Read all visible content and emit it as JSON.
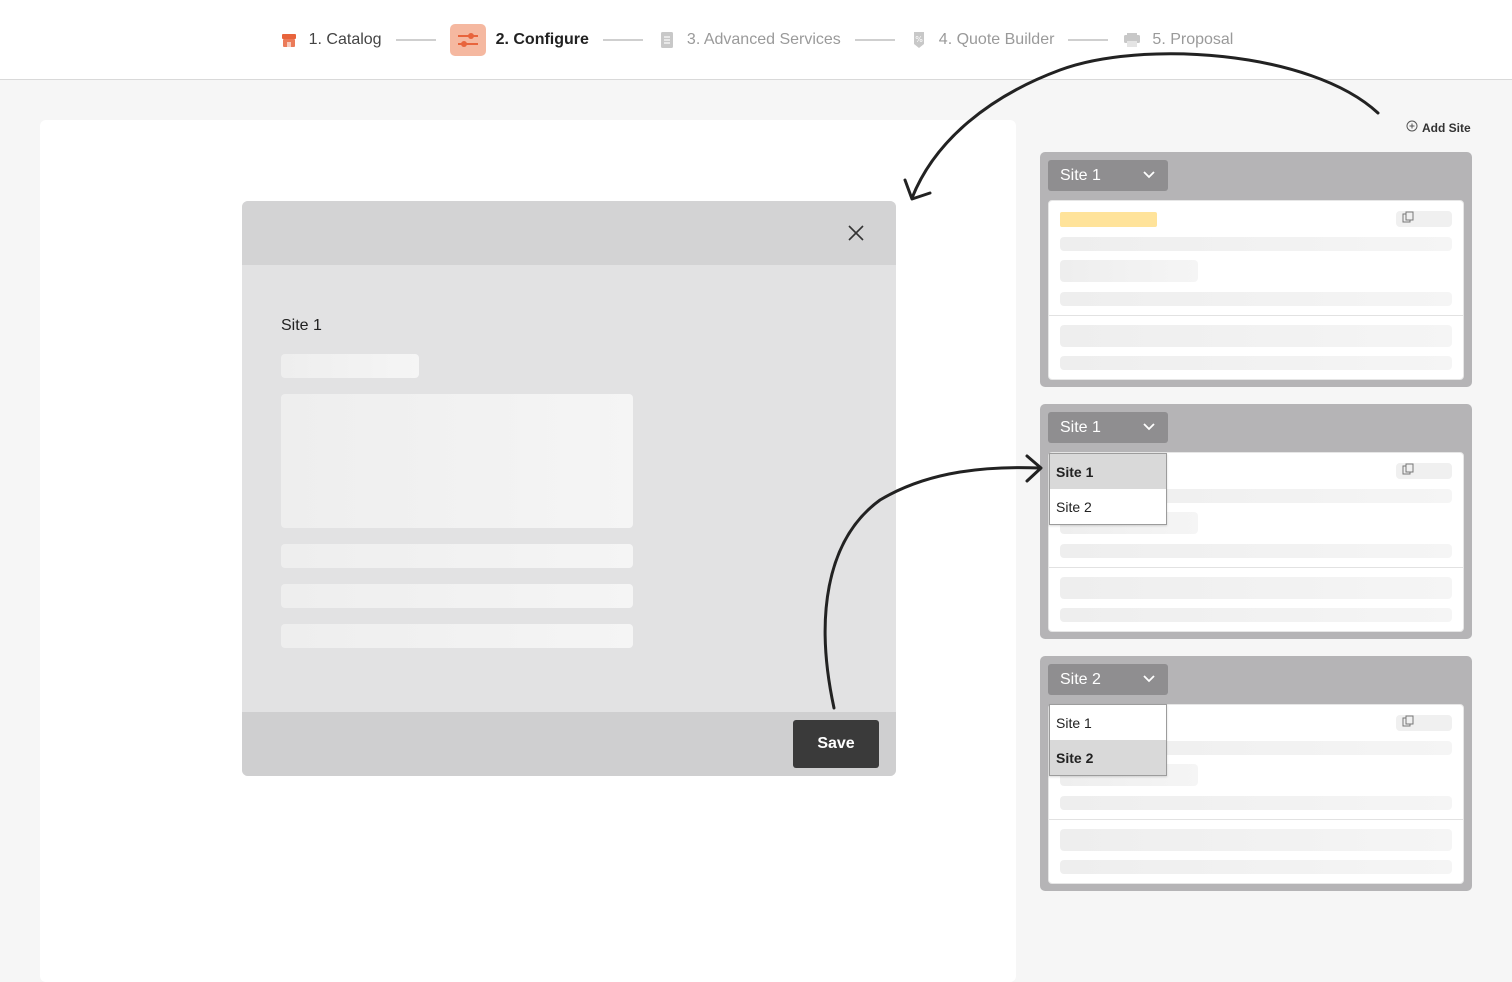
{
  "stepper": {
    "steps": [
      {
        "label": "1. Catalog",
        "icon": "store-icon",
        "state": "done"
      },
      {
        "label": "2. Configure",
        "icon": "sliders-icon",
        "state": "active"
      },
      {
        "label": "3. Advanced Services",
        "icon": "document-icon",
        "state": "pending"
      },
      {
        "label": "4. Quote Builder",
        "icon": "tag-icon",
        "state": "pending"
      },
      {
        "label": "5. Proposal",
        "icon": "printer-icon",
        "state": "pending"
      }
    ],
    "accent_color": "#e8643c",
    "active_bg": "#f5b8a0"
  },
  "modal": {
    "site_label": "Site 1",
    "save_label": "Save"
  },
  "sidebar": {
    "add_site_label": "Add Site",
    "cards": [
      {
        "selected": "Site 1",
        "dropdown_open": false
      },
      {
        "selected": "Site 1",
        "dropdown_open": true,
        "options": [
          "Site 1",
          "Site 2"
        ],
        "highlighted": "Site 1"
      },
      {
        "selected": "Site 2",
        "dropdown_open": true,
        "options": [
          "Site 1",
          "Site 2"
        ],
        "highlighted": "Site 2"
      }
    ],
    "highlight_color": "#ffe39a"
  }
}
